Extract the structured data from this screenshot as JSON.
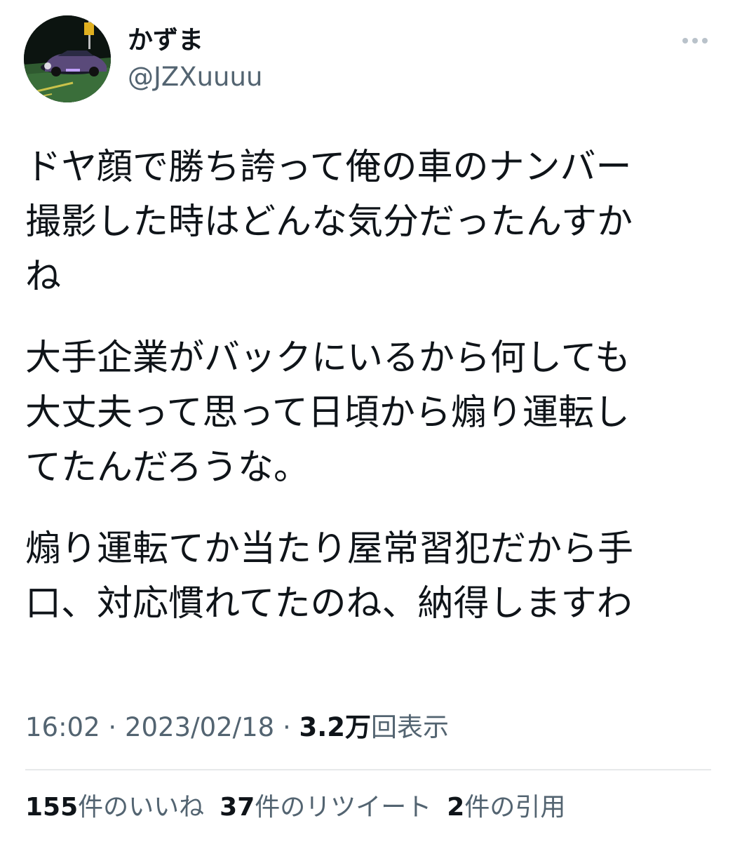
{
  "author": {
    "display_name": "かずま",
    "handle": "@JZXuuuu",
    "avatar_icon": "avatar-car-night-photo"
  },
  "more_icon": "more-dots-icon",
  "tweet": {
    "paragraphs": [
      {
        "lines": [
          "ドヤ顔で勝ち誇って俺の車のナンバー",
          "撮影した時はどんな気分だったんすか",
          "ね"
        ]
      },
      {
        "lines": [
          "大手企業がバックにいるから何しても",
          "大丈夫って思って日頃から煽り運転し",
          "てたんだろうな。"
        ]
      },
      {
        "lines": [
          "煽り運転てか当たり屋常習犯だから手",
          "口、対応慣れてたのね、納得しますわ"
        ]
      }
    ]
  },
  "meta": {
    "time": "16:02",
    "separator": " · ",
    "date": "2023/02/18",
    "views_count": "3.2万",
    "views_label": "回表示"
  },
  "stats": {
    "likes_count": "155",
    "likes_label": "件のいいね",
    "retweets_count": "37",
    "retweets_label": "件のリツイート",
    "quotes_count": "2",
    "quotes_label": "件の引用"
  },
  "colors": {
    "text_primary": "#0f1419",
    "text_secondary": "#536471",
    "divider": "#e7e9ea"
  }
}
